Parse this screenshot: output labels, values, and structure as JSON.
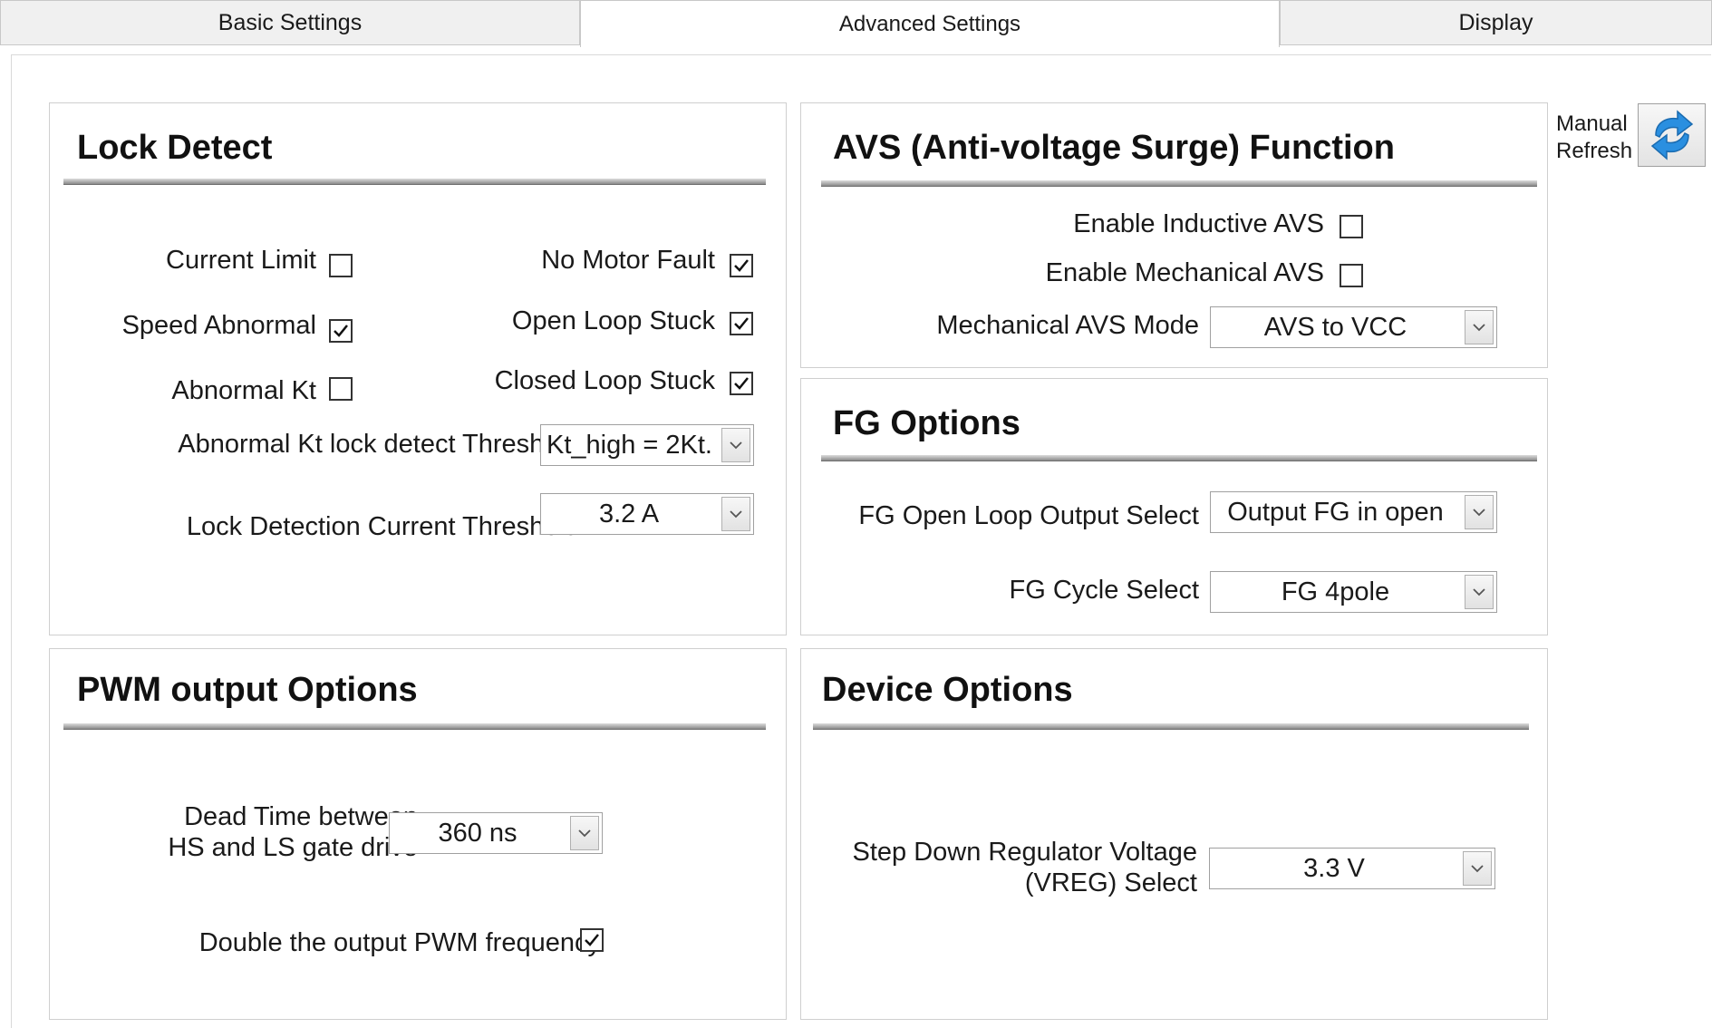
{
  "tabs": [
    {
      "label": "Basic Settings"
    },
    {
      "label": "Advanced Settings"
    },
    {
      "label": "Display"
    }
  ],
  "refresh": {
    "line1": "Manual",
    "line2": "Refresh"
  },
  "lock_detect": {
    "title": "Lock Detect",
    "current_limit": {
      "label": "Current Limit",
      "checked": false
    },
    "speed_abnormal": {
      "label": "Speed Abnormal",
      "checked": true
    },
    "abnormal_kt": {
      "label": "Abnormal Kt",
      "checked": false
    },
    "no_motor_fault": {
      "label": "No Motor Fault",
      "checked": true
    },
    "open_loop_stuck": {
      "label": "Open Loop Stuck",
      "checked": true
    },
    "closed_loop_stuck": {
      "label": "Closed Loop Stuck",
      "checked": true
    },
    "kt_threshold": {
      "label": "Abnormal Kt lock detect Threshold",
      "value": "Kt_high = 2Kt."
    },
    "current_threshold": {
      "label": "Lock Detection Current Threshold",
      "value": "3.2 A"
    }
  },
  "avs": {
    "title": "AVS (Anti-voltage Surge) Function",
    "inductive": {
      "label": "Enable Inductive AVS",
      "checked": false
    },
    "mechanical": {
      "label": "Enable Mechanical AVS",
      "checked": false
    },
    "mode": {
      "label": "Mechanical AVS Mode",
      "value": "AVS to VCC"
    }
  },
  "fg": {
    "title": "FG Options",
    "open_loop": {
      "label": "FG Open Loop Output Select",
      "value": "Output FG in open"
    },
    "cycle": {
      "label": "FG Cycle Select",
      "value": "FG 4pole"
    }
  },
  "pwm": {
    "title": "PWM output Options",
    "dead_time": {
      "label_line1": "Dead Time between",
      "label_line2": "HS and LS gate drive",
      "value": "360 ns"
    },
    "double_freq": {
      "label": "Double the output PWM frequency",
      "checked": true
    }
  },
  "device": {
    "title": "Device Options",
    "vreg": {
      "label_line1": "Step Down Regulator Voltage",
      "label_line2": "(VREG) Select",
      "value": "3.3 V"
    }
  }
}
